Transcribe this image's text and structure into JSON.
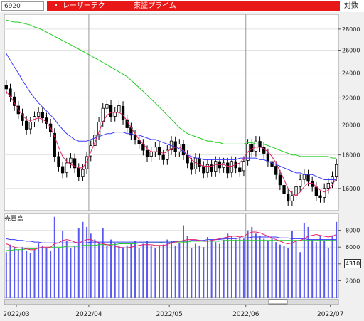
{
  "header": {
    "code": "6920",
    "dot": "・",
    "company": "レーザーテク",
    "market": "東証プライム",
    "scale_label": "対数"
  },
  "volume_panel": {
    "title": "売買高",
    "current_value": "4310"
  },
  "colors": {
    "up_candle": "#ffffff",
    "down_candle": "#000000",
    "ma_short": "#e8206a",
    "ma_mid": "#3a3aff",
    "ma_long": "#22cc22",
    "volume_bar": "#5a5af0",
    "name_bar": "#e81818"
  },
  "chart_data": [
    {
      "type": "candlestick",
      "title": "",
      "y_scale": "log",
      "ylim": [
        14800,
        29500
      ],
      "y_ticks": [
        16000,
        18000,
        20000,
        22000,
        24000,
        26000,
        28000
      ],
      "x_labels": [
        "2022/03",
        "2022/04",
        "2022/05",
        "2022/06",
        "2022/07"
      ],
      "x_label_index": [
        3,
        21,
        41,
        60,
        81
      ],
      "month_divider_index": [
        21,
        60
      ],
      "close": [
        22700,
        22100,
        21400,
        20800,
        20300,
        19700,
        20200,
        20600,
        20900,
        20500,
        20100,
        19500,
        17900,
        17300,
        16900,
        17500,
        17800,
        17200,
        16700,
        17100,
        17900,
        18600,
        19300,
        20200,
        21200,
        21500,
        20600,
        20900,
        21400,
        20400,
        19800,
        19300,
        19000,
        18700,
        18300,
        17900,
        18200,
        18500,
        18000,
        17700,
        18300,
        18900,
        18200,
        18700,
        18000,
        17500,
        17100,
        17800,
        17300,
        16900,
        17400,
        17000,
        17600,
        17200,
        17500,
        16900,
        17600,
        17200,
        17000,
        17600,
        18700,
        18200,
        18900,
        18500,
        18100,
        17600,
        17300,
        16800,
        16200,
        15700,
        15300,
        15600,
        16100,
        16500,
        16800,
        16400,
        16100,
        15600,
        15500,
        16000,
        16300,
        16700,
        17400
      ],
      "ma_short": [
        22500,
        22100,
        21600,
        21100,
        20700,
        20400,
        20300,
        20400,
        20500,
        20400,
        20200,
        19800,
        19200,
        18500,
        17900,
        17600,
        17400,
        17300,
        17200,
        17200,
        17600,
        18200,
        18800,
        19500,
        20200,
        20700,
        20900,
        20900,
        20900,
        20700,
        20300,
        19800,
        19400,
        19000,
        18700,
        18400,
        18200,
        18200,
        18200,
        18100,
        18200,
        18400,
        18500,
        18500,
        18300,
        18000,
        17700,
        17500,
        17400,
        17300,
        17300,
        17300,
        17400,
        17400,
        17400,
        17300,
        17300,
        17400,
        17500,
        17800,
        18200,
        18400,
        18500,
        18500,
        18400,
        18200,
        17900,
        17500,
        17000,
        16500,
        16000,
        15700,
        15600,
        15800,
        16100,
        16300,
        16300,
        16100,
        15900,
        15800,
        15900,
        16200,
        16600
      ],
      "ma_mid": [
        25700,
        25100,
        24500,
        24000,
        23400,
        22900,
        22400,
        22000,
        21600,
        21300,
        21000,
        20700,
        20400,
        20000,
        19700,
        19400,
        19200,
        19000,
        18900,
        18900,
        18900,
        19000,
        19100,
        19200,
        19300,
        19400,
        19400,
        19500,
        19500,
        19500,
        19400,
        19400,
        19300,
        19300,
        19200,
        19100,
        19000,
        19000,
        18900,
        18800,
        18700,
        18600,
        18500,
        18400,
        18200,
        18000,
        17900,
        17800,
        17800,
        17700,
        17700,
        17700,
        17700,
        17700,
        17700,
        17700,
        17700,
        17700,
        17800,
        17800,
        17800,
        17800,
        17800,
        17700,
        17700,
        17600,
        17500,
        17400,
        17300,
        17200,
        17100,
        17000,
        16900,
        16900,
        16800,
        16800,
        16800,
        16700,
        16600,
        16500,
        16500,
        16500,
        16500
      ],
      "ma_long": [
        28900,
        28800,
        28700,
        28700,
        28600,
        28500,
        28400,
        28200,
        28100,
        27900,
        27700,
        27500,
        27300,
        27100,
        26900,
        26700,
        26500,
        26300,
        26100,
        25900,
        25700,
        25500,
        25300,
        25100,
        24900,
        24700,
        24500,
        24300,
        24100,
        23900,
        23700,
        23400,
        23100,
        22800,
        22500,
        22200,
        21900,
        21600,
        21300,
        21000,
        20700,
        20400,
        20100,
        19800,
        19600,
        19400,
        19300,
        19200,
        19100,
        19000,
        18900,
        18900,
        18800,
        18800,
        18700,
        18700,
        18700,
        18700,
        18700,
        18700,
        18800,
        18800,
        18700,
        18700,
        18700,
        18600,
        18500,
        18400,
        18300,
        18200,
        18100,
        18000,
        18000,
        17900,
        17900,
        17900,
        17900,
        17900,
        17900,
        17900,
        17900,
        17800,
        17800
      ]
    },
    {
      "type": "bar",
      "title": "",
      "ylim": [
        0,
        10000
      ],
      "y_ticks": [
        2000,
        4000,
        6000,
        8000
      ],
      "values": [
        5400,
        6300,
        6000,
        5700,
        6000,
        5600,
        5300,
        5700,
        6500,
        6200,
        5900,
        5600,
        9600,
        5900,
        7900,
        6700,
        5900,
        6200,
        8300,
        9000,
        8400,
        7600,
        6900,
        6500,
        8300,
        6200,
        6900,
        6500,
        6200,
        6000,
        6200,
        6500,
        6700,
        5900,
        6400,
        6700,
        6200,
        5900,
        6100,
        6300,
        6900,
        6700,
        6200,
        6500,
        8600,
        7300,
        5900,
        6400,
        6200,
        6000,
        7200,
        6900,
        6600,
        6400,
        6900,
        7600,
        7300,
        6900,
        7200,
        7000,
        8000,
        8400,
        7600,
        7300,
        7000,
        6800,
        7100,
        6600,
        6300,
        6100,
        5900,
        7900,
        6800,
        5400,
        8900,
        8400,
        6900,
        6600,
        7300,
        6800,
        5900,
        7400,
        9000
      ],
      "ma_short": [
        6400,
        6200,
        6000,
        5900,
        5900,
        5800,
        5700,
        5700,
        5900,
        6000,
        6000,
        6000,
        6400,
        6500,
        6800,
        6900,
        6800,
        6600,
        6500,
        6700,
        6900,
        6900,
        6700,
        6500,
        6400,
        6300,
        6200,
        6100,
        6000,
        5900,
        5900,
        6000,
        6100,
        6200,
        6300,
        6300,
        6300,
        6200,
        6200,
        6200,
        6300,
        6500,
        6600,
        6700,
        6800,
        6900,
        6900,
        6900,
        6800,
        6700,
        6700,
        6800,
        6900,
        7000,
        7100,
        7200,
        7300,
        7300,
        7200,
        7300,
        7600,
        7800,
        7800,
        7700,
        7500,
        7300,
        7100,
        6900,
        6700,
        6500,
        6400,
        6500,
        6700,
        6800,
        7000,
        7300,
        7400,
        7500,
        7400,
        7300,
        7200,
        7300,
        7500
      ],
      "ma_mid": [
        7000,
        6900,
        6900,
        6800,
        6800,
        6700,
        6700,
        6600,
        6600,
        6500,
        6500,
        6500,
        6500,
        6500,
        6500,
        6500,
        6500,
        6500,
        6500,
        6500,
        6500,
        6600,
        6600,
        6600,
        6600,
        6600,
        6600,
        6600,
        6600,
        6600,
        6600,
        6600,
        6600,
        6600,
        6600,
        6600,
        6600,
        6600,
        6600,
        6600,
        6600,
        6600,
        6700,
        6700,
        6700,
        6700,
        6800,
        6800,
        6800,
        6800,
        6900,
        6900,
        6900,
        6900,
        7000,
        7000,
        7000,
        7000,
        7100,
        7100,
        7100,
        7200,
        7200,
        7200,
        7200,
        7200,
        7200,
        7200,
        7100,
        7100,
        7100,
        7000,
        7000,
        7000,
        7000,
        6900,
        6900,
        6900,
        6900,
        6900,
        6900,
        6900,
        6900
      ],
      "ma_long": [
        5600,
        5600,
        5700,
        5700,
        5700,
        5800,
        5800,
        5800,
        5900,
        5900,
        5900,
        6000,
        6000,
        6000,
        6000,
        6100,
        6100,
        6100,
        6100,
        6200,
        6200,
        6200,
        6200,
        6300,
        6300,
        6300,
        6300,
        6300,
        6400,
        6400,
        6400,
        6400,
        6400,
        6500,
        6500,
        6500,
        6500,
        6500,
        6500,
        6600,
        6600,
        6600,
        6600,
        6600,
        6600,
        6600,
        6700,
        6700,
        6700,
        6700,
        6700,
        6700,
        6700,
        6700,
        6800,
        6800,
        6800,
        6800,
        6800,
        6800,
        6800,
        6800,
        6800,
        6800,
        6800,
        6800,
        6800,
        6800,
        6800,
        6800,
        6800,
        6800,
        6800,
        6800,
        6800,
        6800,
        6800,
        6800,
        6800,
        6800,
        6800,
        6800,
        6800
      ]
    }
  ]
}
